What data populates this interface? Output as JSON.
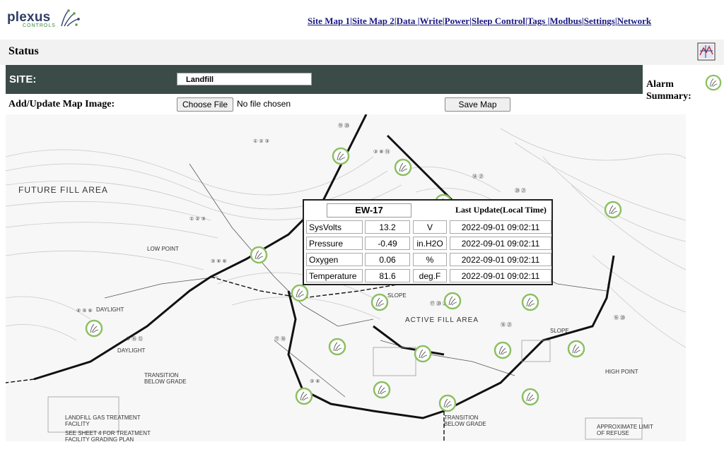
{
  "brand": {
    "name": "plexus",
    "sub": "CONTROLS"
  },
  "nav": [
    {
      "label": "Site Map 1"
    },
    {
      "label": "Site Map 2"
    },
    {
      "label": "Data "
    },
    {
      "label": "Write"
    },
    {
      "label": "Power"
    },
    {
      "label": "Sleep Control"
    },
    {
      "label": "Tags "
    },
    {
      "label": "Modbus"
    },
    {
      "label": "Settings"
    },
    {
      "label": "Network"
    }
  ],
  "status": {
    "title": "Status"
  },
  "site": {
    "label": "SITE:",
    "selected": "Landfill"
  },
  "alarm": {
    "label_line1": "Alarm",
    "label_line2": "Summary:"
  },
  "map_upload": {
    "label": "Add/Update Map Image:",
    "choose_label": "Choose File",
    "file_status": "No file chosen",
    "save_label": "Save Map"
  },
  "map_labels": {
    "future_fill": "FUTURE FILL AREA",
    "active_fill": "ACTIVE FILL AREA",
    "daylight": "DAYLIGHT",
    "slope": "SLOPE",
    "lfg": "LANDFILL GAS TREATMENT FACILITY",
    "see_sheet": "SEE SHEET 4 FOR TREATMENT FACILITY GRADING PLAN",
    "approx": "APPROXIMATE LIMIT OF REFUSE",
    "transition": "TRANSITION BELOW GRADE",
    "high_point": "HIGH POINT",
    "low_point": "LOW POINT"
  },
  "popup": {
    "well_name": "EW-17",
    "time_header": "Last Update(Local Time)",
    "rows": [
      {
        "label": "SysVolts",
        "value": "13.2",
        "unit": "V",
        "time": "2022-09-01 09:02:11"
      },
      {
        "label": "Pressure",
        "value": "-0.49",
        "unit": "in.H2O",
        "time": "2022-09-01 09:02:11"
      },
      {
        "label": "Oxygen",
        "value": "0.06",
        "unit": "%",
        "time": "2022-09-01 09:02:11"
      },
      {
        "label": "Temperature",
        "value": "81.6",
        "unit": "deg.F",
        "time": "2022-09-01 09:02:11"
      }
    ]
  },
  "colors": {
    "header_bar": "#3b4b48",
    "nav_link": "#1a1a80",
    "well_ring": "#8cc063"
  }
}
